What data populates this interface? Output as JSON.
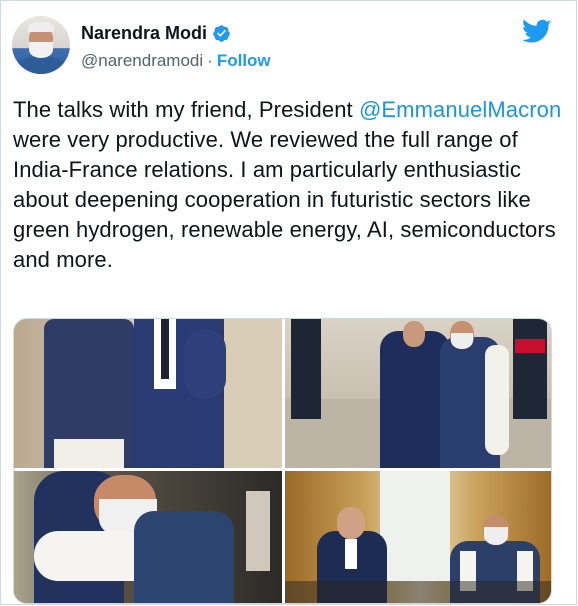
{
  "author": {
    "name": "Narendra Modi",
    "handle": "@narendramodi",
    "separator": "·",
    "follow_label": "Follow",
    "verified_icon": "verified-badge-icon"
  },
  "brand": {
    "icon": "twitter-bird-icon",
    "color": "#1d9bf0"
  },
  "tweet": {
    "text_before": "The talks with my friend, President ",
    "mention": "@EmmanuelMacron",
    "text_after": " were very productive. We reviewed the full range of India-France relations. I am particularly enthusiastic about deepening cooperation in futuristic sectors like green hydrogen, renewable energy, AI, semiconductors and more."
  },
  "media": {
    "photos": [
      "photo-leaders-embrace-closeup",
      "photo-leaders-handshake-palace",
      "photo-leaders-hug",
      "photo-leaders-seated-meeting"
    ]
  },
  "colors": {
    "text": "#0f1419",
    "secondary": "#536471",
    "link": "#1d9bf0",
    "mention": "#1b95e0",
    "border": "#cfd9de"
  }
}
